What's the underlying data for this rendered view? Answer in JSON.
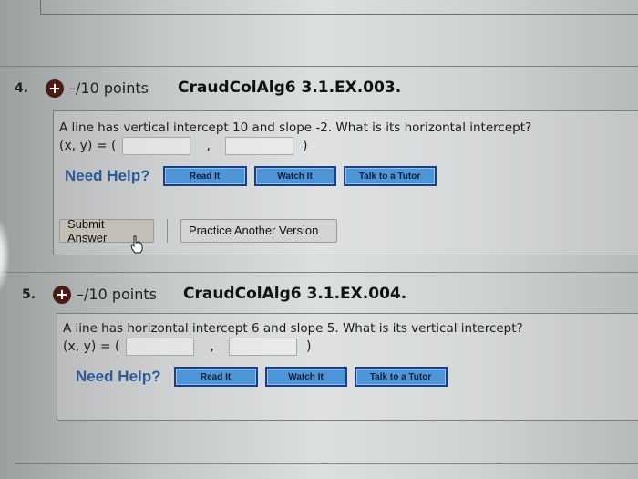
{
  "questions": [
    {
      "number": "4.",
      "points": "–/10 points",
      "code": "CraudColAlg6 3.1.EX.003.",
      "text": "A line has vertical intercept 10 and slope -2. What is its horizontal intercept?",
      "answer_label": "(x, y) = (",
      "answer_x": "",
      "answer_y": "",
      "comma": ",",
      "close_paren": ")",
      "need_help": "Need Help?",
      "help_buttons": [
        "Read It",
        "Watch It",
        "Talk to a Tutor"
      ],
      "submit_label": "Submit Answer",
      "practice_label": "Practice Another Version"
    },
    {
      "number": "5.",
      "points": "–/10 points",
      "code": "CraudColAlg6 3.1.EX.004.",
      "text": "A line has horizontal intercept 6 and slope 5. What is its vertical intercept?",
      "answer_label": "(x, y) = (",
      "answer_x": "",
      "answer_y": "",
      "comma": ",",
      "close_paren": ")",
      "need_help": "Need Help?",
      "help_buttons": [
        "Read It",
        "Watch It",
        "Talk to a Tutor"
      ]
    }
  ],
  "icons": {
    "expand": "+",
    "cursor": "hand-pointer"
  },
  "colors": {
    "help_text": "#2d5a99",
    "help_button": "#4e95d8",
    "expand_icon": "#4a1a14"
  }
}
